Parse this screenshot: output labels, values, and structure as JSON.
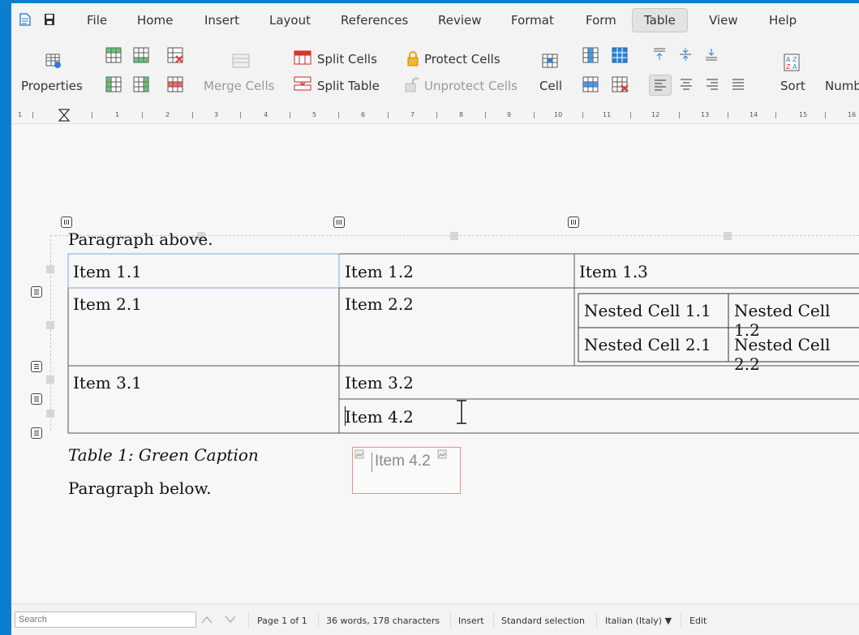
{
  "menubar": {
    "items": [
      "File",
      "Home",
      "Insert",
      "Layout",
      "References",
      "Review",
      "Format",
      "Form",
      "Table",
      "View",
      "Help"
    ],
    "active": "Table"
  },
  "toolbar": {
    "properties": "Properties",
    "merge_cells": "Merge Cells",
    "split_cells": "Split Cells",
    "split_table": "Split Table",
    "protect_cells": "Protect Cells",
    "unprotect_cells": "Unprotect Cells",
    "cell": "Cell",
    "sort": "Sort",
    "number": "Numb"
  },
  "ruler": {
    "marks": [
      "1",
      "1",
      "1",
      "2",
      "3",
      "4",
      "5",
      "6",
      "7",
      "8",
      "9",
      "10",
      "11",
      "12",
      "13",
      "14",
      "15",
      "16"
    ]
  },
  "document": {
    "paragraph_above": "Paragraph above.",
    "table": {
      "r1": [
        "Item 1.1",
        "Item 1.2",
        "Item 1.3"
      ],
      "r2": [
        "Item 2.1",
        "Item 2.2"
      ],
      "nested": [
        [
          "Nested Cell 1.1",
          "Nested Cell 1.2"
        ],
        [
          "Nested Cell 2.1",
          "Nested Cell 2.2"
        ]
      ],
      "r3": [
        "Item 3.1",
        "Item 3.2"
      ],
      "r4": [
        "Item 4.2"
      ]
    },
    "caption": "Table 1: Green Caption",
    "paragraph_below": "Paragraph below.",
    "drag_preview": "Item 4.2"
  },
  "statusbar": {
    "search_placeholder": "Search",
    "page": "Page 1 of 1",
    "counts": "36 words, 178 characters",
    "mode": "Insert",
    "selection": "Standard selection",
    "language": "Italian (Italy) ▼",
    "edit": "Edit"
  },
  "colors": {
    "frame": "#0a7fd0",
    "accent_green": "#3aa04a",
    "accent_red": "#d9342b",
    "accent_blue": "#2a7fd6"
  }
}
